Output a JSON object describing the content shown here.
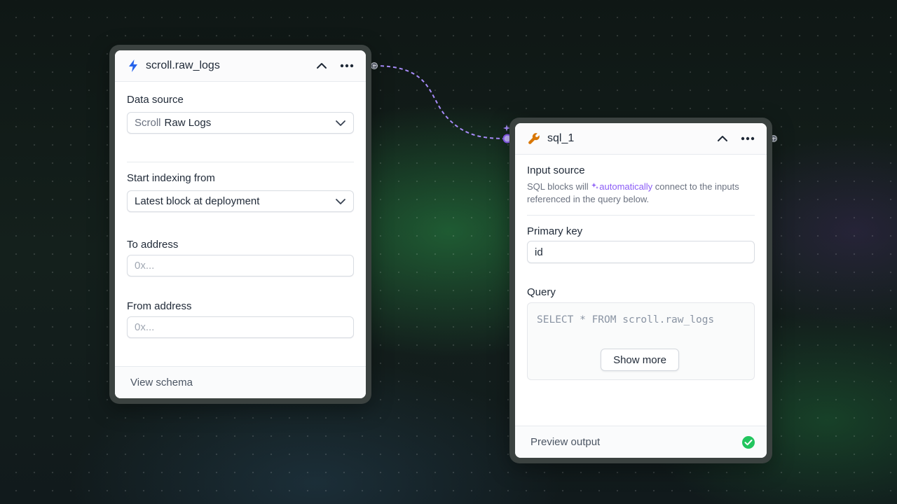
{
  "nodes": {
    "source": {
      "title": "scroll.raw_logs",
      "icon": "lightning-icon",
      "fields": {
        "data_source": {
          "label": "Data source",
          "value_prefix": "Scroll",
          "value": "Raw Logs"
        },
        "start_indexing": {
          "label": "Start indexing from",
          "value": "Latest block at deployment"
        },
        "to_address": {
          "label": "To address",
          "placeholder": "0x..."
        },
        "from_address": {
          "label": "From address",
          "placeholder": "0x..."
        }
      },
      "footer": "View schema"
    },
    "sql": {
      "title": "sql_1",
      "icon": "wrench-icon",
      "input_source": {
        "label": "Input source",
        "desc_before": "SQL blocks will",
        "desc_highlight": "automatically",
        "desc_after": "connect to the inputs referenced in the query below."
      },
      "primary_key": {
        "label": "Primary key",
        "value": "id"
      },
      "query": {
        "label": "Query",
        "code": "SELECT * FROM scroll.raw_logs",
        "show_more": "Show more"
      },
      "footer": "Preview output",
      "status_icon": "check-circle-icon"
    }
  },
  "colors": {
    "accent_purple": "#8b5cf6",
    "lightning_blue": "#2563eb",
    "wrench_orange": "#d97706",
    "success_green": "#22c55e"
  }
}
